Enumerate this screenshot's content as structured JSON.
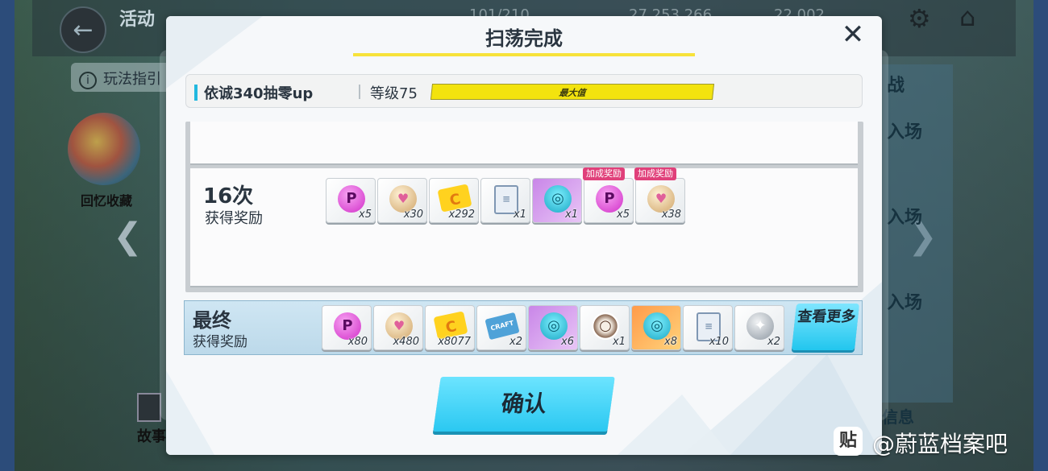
{
  "background": {
    "title": "活动",
    "resources": [
      "101/210",
      "27,253,266",
      "22,002"
    ],
    "guide_label": "玩法指引",
    "recall_label": "回忆收藏",
    "entry_labels": [
      "入场",
      "入场",
      "入场"
    ],
    "side_top_label": "战",
    "story_label": "故事",
    "info_label": "信息"
  },
  "dialog": {
    "title": "扫荡完成",
    "close_icon": "close-icon",
    "stage_name": "依诚340抽零up",
    "level_label": "等级75",
    "level_bar_label": "最大值",
    "level_progress": 1.0,
    "round": {
      "count_label": "16次",
      "sub_label": "获得奖励",
      "items": [
        {
          "icon": "p-coin-icon",
          "glyph": "P",
          "qty": "x5",
          "bonus": ""
        },
        {
          "icon": "heart-orb-icon",
          "glyph": "♥",
          "qty": "x30",
          "bonus": ""
        },
        {
          "icon": "c-ticket-icon",
          "glyph": "C",
          "qty": "x292",
          "bonus": ""
        },
        {
          "icon": "clipboard-icon",
          "glyph": "≡",
          "qty": "x1",
          "bonus": ""
        },
        {
          "icon": "bowl-icon",
          "glyph": "◎",
          "qty": "x1",
          "bonus": "",
          "rare": true
        },
        {
          "icon": "p-coin-icon",
          "glyph": "P",
          "qty": "x5",
          "bonus": "加成奖励"
        },
        {
          "icon": "heart-orb-icon",
          "glyph": "♥",
          "qty": "x38",
          "bonus": "加成奖励"
        }
      ]
    },
    "final": {
      "title": "最终",
      "sub_label": "获得奖励",
      "items": [
        {
          "icon": "p-coin-icon",
          "glyph": "P",
          "qty": "x80"
        },
        {
          "icon": "heart-orb-icon",
          "glyph": "♥",
          "qty": "x480"
        },
        {
          "icon": "c-ticket-icon",
          "glyph": "C",
          "qty": "x8077"
        },
        {
          "icon": "craft-ticket-icon",
          "glyph": "CRAFT",
          "qty": "x2"
        },
        {
          "icon": "bowl-icon",
          "glyph": "◎",
          "qty": "x6",
          "rare": true
        },
        {
          "icon": "ring-icon",
          "glyph": "○",
          "qty": "x1"
        },
        {
          "icon": "bowl-icon",
          "glyph": "◎",
          "qty": "x8",
          "gold": true
        },
        {
          "icon": "clipboard-icon",
          "glyph": "≡",
          "qty": "x10"
        },
        {
          "icon": "grey-orb-icon",
          "glyph": "✦",
          "qty": "x2"
        }
      ],
      "see_more_label": "查看更多"
    },
    "confirm_label": "确认"
  },
  "watermark": {
    "icon_glyph": "贴",
    "text": "@蔚蓝档案吧"
  },
  "colors": {
    "accent_cyan": "#2bc8f1",
    "level_yellow": "#f3e30e",
    "bonus_pink": "#e0407a",
    "title_underline": "#f7e23a"
  }
}
